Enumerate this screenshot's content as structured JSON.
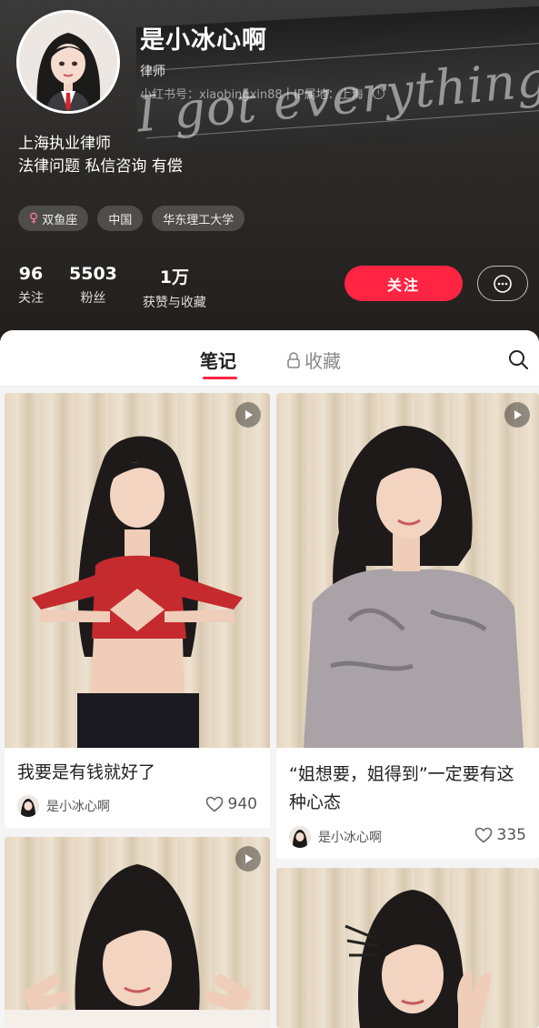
{
  "profile": {
    "name": "是小冰心啊",
    "role": "律师",
    "id_text": "小红书号：xiaobingxin88",
    "ip_text": "IP属地：上海",
    "bg_text": "I got everything.",
    "bio_line1": "上海执业律师",
    "bio_line2": "法律问题 私信咨询 有偿",
    "tags": [
      {
        "label": "双鱼座",
        "icon": "female-icon"
      },
      {
        "label": "中国"
      },
      {
        "label": "华东理工大学"
      }
    ]
  },
  "stats": [
    {
      "num": "96",
      "label": "关注"
    },
    {
      "num": "5503",
      "label": "粉丝"
    },
    {
      "num": "1万",
      "label": "获赞与收藏"
    }
  ],
  "actions": {
    "follow_label": "关注",
    "message_icon": "chat-bubble-icon"
  },
  "tabs": {
    "notes": "笔记",
    "favorites": "收藏",
    "favorites_icon": "lock-icon"
  },
  "colors": {
    "accent": "#ff2442"
  },
  "notes": [
    {
      "title": "我要是有钱就好了",
      "author": "是小冰心啊",
      "likes": "940",
      "video": true
    },
    {
      "title": "“姐想要，姐得到”一定要有这种心态",
      "author": "是小冰心啊",
      "likes": "335",
      "video": true
    },
    {
      "title": "",
      "author": "",
      "likes": "",
      "video": true
    },
    {
      "title": "",
      "author": "",
      "likes": "",
      "video": false
    }
  ]
}
